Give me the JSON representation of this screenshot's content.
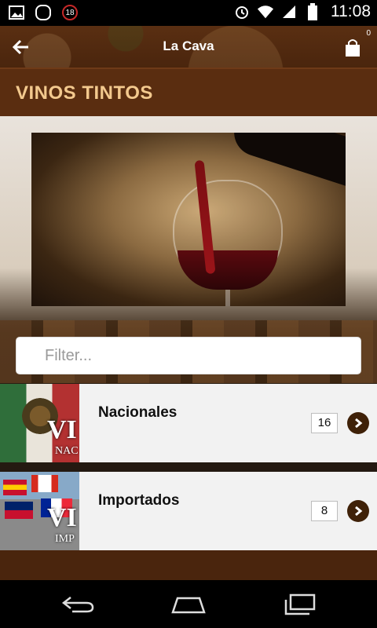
{
  "status_bar": {
    "time": "11:08",
    "notification_badge": "18",
    "icons": [
      "image-icon",
      "circle-app-icon",
      "badge-icon",
      "alarm-icon",
      "wifi-icon",
      "signal-icon",
      "battery-icon"
    ]
  },
  "app_bar": {
    "title": "La Cava",
    "cart_count": "0"
  },
  "section": {
    "title": "VINOS TINTOS"
  },
  "filter": {
    "placeholder": "Filter..."
  },
  "categories": [
    {
      "label": "Nacionales",
      "count": "16",
      "thumb_text": "VI",
      "thumb_sub": "NAC"
    },
    {
      "label": "Importados",
      "count": "8",
      "thumb_text": "VI",
      "thumb_sub": "IMP"
    }
  ],
  "colors": {
    "brand_brown": "#4a250d",
    "title_accent": "#f3c98e",
    "arrow_bg": "#3f2108"
  }
}
